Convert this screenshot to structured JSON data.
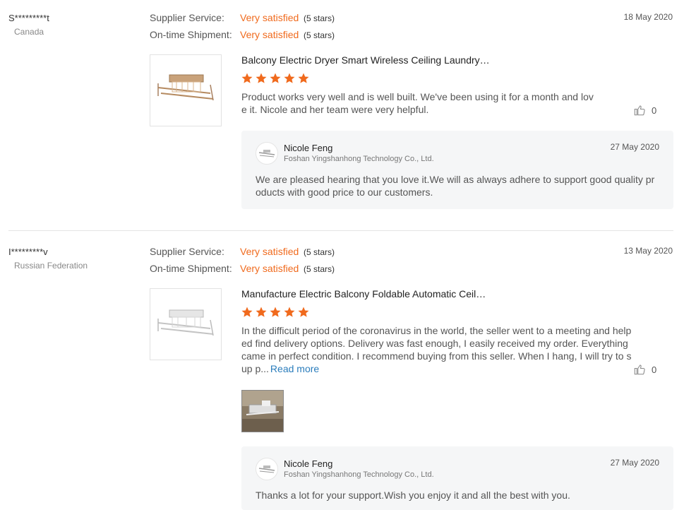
{
  "reviews": [
    {
      "reviewer": "S*********t",
      "country": "Canada",
      "date": "18 May 2020",
      "supplier_label": "Supplier Service:",
      "supplier_value": "Very satisfied",
      "supplier_stars": "(5 stars)",
      "shipment_label": "On-time Shipment:",
      "shipment_value": "Very satisfied",
      "shipment_stars": "(5 stars)",
      "product_title": "Balcony Electric Dryer Smart Wireless Ceiling Laundry…",
      "rating": 5,
      "text": "Product works very well and is well built. We've been using it for a month and love it. Nicole and her team were very helpful.",
      "likes": "0",
      "reply": {
        "name": "Nicole Feng",
        "company": "Foshan Yingshanhong Technology Co., Ltd.",
        "date": "27 May 2020",
        "text": "We are pleased hearing that you love it.We will as always adhere to support good quality products with good price to our customers."
      }
    },
    {
      "reviewer": "I*********v",
      "country": "Russian Federation",
      "date": "13 May 2020",
      "supplier_label": "Supplier Service:",
      "supplier_value": "Very satisfied",
      "supplier_stars": "(5 stars)",
      "shipment_label": "On-time Shipment:",
      "shipment_value": "Very satisfied",
      "shipment_stars": "(5 stars)",
      "product_title": "Manufacture Electric Balcony Foldable Automatic Ceil…",
      "rating": 5,
      "text": "In the difficult period of the coronavirus in the world, the seller went to a meeting and helped find delivery options. Delivery was fast enough, I easily received my order. Everything came in perfect condition. I recommend buying from this seller. When I hang, I will try to sup p...",
      "read_more": "Read more",
      "likes": "0",
      "reply": {
        "name": "Nicole Feng",
        "company": "Foshan Yingshanhong Technology Co., Ltd.",
        "date": "27 May 2020",
        "text": "Thanks a lot for your support.Wish you enjoy it and all the best with you."
      }
    }
  ],
  "colors": {
    "accent": "#f06a1d",
    "link": "#2b7dbc",
    "reply_bg": "#f5f6f7"
  },
  "icons": {
    "star": "star-icon",
    "like": "thumbs-up-icon"
  }
}
